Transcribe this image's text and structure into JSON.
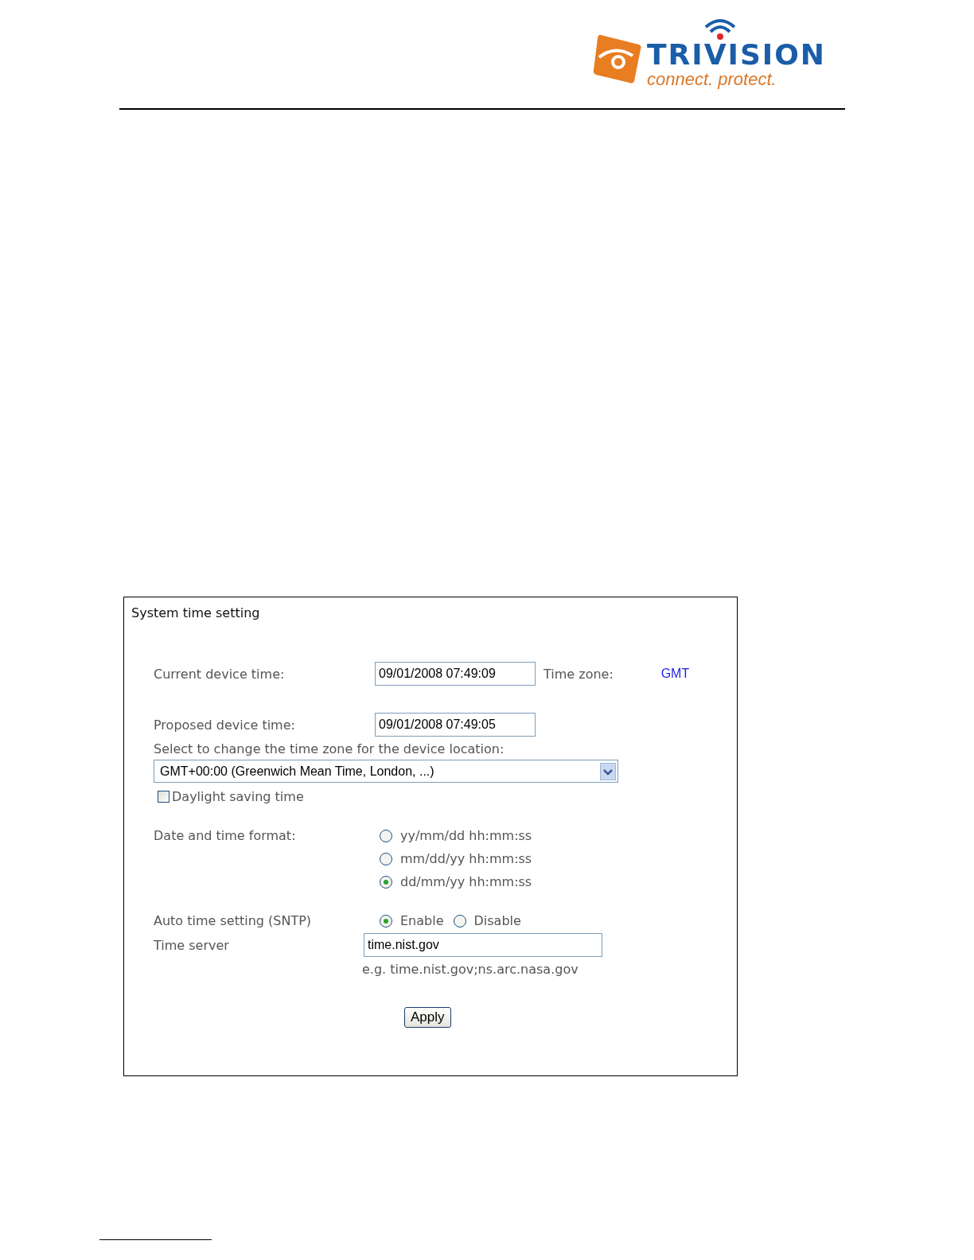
{
  "logo": {
    "name": "TRIVISION",
    "tagline": "connect. protect."
  },
  "panel": {
    "title": "System time setting",
    "current_time": {
      "label": "Current device time:",
      "value": "09/01/2008 07:49:09",
      "zone_label": "Time zone:",
      "zone_value": "GMT"
    },
    "proposed_time": {
      "label": "Proposed device time:",
      "value": "09/01/2008 07:49:05"
    },
    "timezone": {
      "label": "Select to change the time zone for the device location:",
      "value": "GMT+00:00 (Greenwich Mean Time, London, ...)"
    },
    "daylight_saving": {
      "label": "Daylight saving time",
      "checked": false
    },
    "format": {
      "label": "Date and time format:",
      "options": [
        {
          "label": "yy/mm/dd hh:mm:ss",
          "selected": false
        },
        {
          "label": "mm/dd/yy hh:mm:ss",
          "selected": false
        },
        {
          "label": "dd/mm/yy hh:mm:ss",
          "selected": true
        }
      ]
    },
    "sntp": {
      "label": "Auto time setting (SNTP)",
      "options": [
        {
          "label": "Enable",
          "selected": true
        },
        {
          "label": "Disable",
          "selected": false
        }
      ]
    },
    "server": {
      "label": "Time server",
      "value": "time.nist.gov",
      "hint": "e.g. time.nist.gov;ns.arc.nasa.gov"
    },
    "apply": "Apply"
  }
}
